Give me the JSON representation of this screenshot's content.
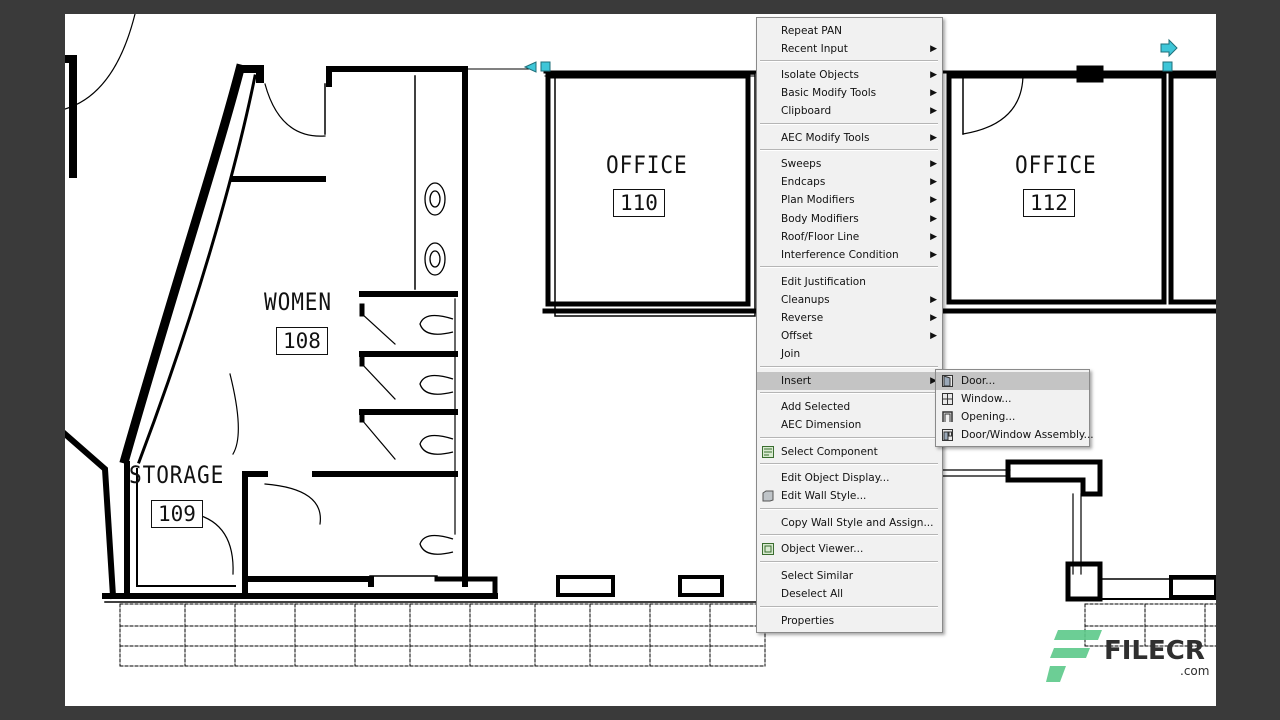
{
  "rooms": [
    {
      "name": "WOMEN",
      "number": "108"
    },
    {
      "name": "STORAGE",
      "number": "109"
    },
    {
      "name": "OFFICE",
      "number": "110"
    },
    {
      "name": "OFFICE",
      "number": "112"
    }
  ],
  "context_menu": {
    "groups": [
      [
        {
          "label": "Repeat PAN",
          "submenu": false
        },
        {
          "label": "Recent Input",
          "submenu": true
        }
      ],
      [
        {
          "label": "Isolate Objects",
          "submenu": true
        },
        {
          "label": "Basic Modify Tools",
          "submenu": true
        },
        {
          "label": "Clipboard",
          "submenu": true
        }
      ],
      [
        {
          "label": "AEC Modify Tools",
          "submenu": true
        }
      ],
      [
        {
          "label": "Sweeps",
          "submenu": true
        },
        {
          "label": "Endcaps",
          "submenu": true
        },
        {
          "label": "Plan Modifiers",
          "submenu": true
        },
        {
          "label": "Body Modifiers",
          "submenu": true
        },
        {
          "label": "Roof/Floor Line",
          "submenu": true
        },
        {
          "label": "Interference Condition",
          "submenu": true
        }
      ],
      [
        {
          "label": "Edit Justification",
          "submenu": false
        },
        {
          "label": "Cleanups",
          "submenu": true
        },
        {
          "label": "Reverse",
          "submenu": true
        },
        {
          "label": "Offset",
          "submenu": true
        },
        {
          "label": "Join",
          "submenu": false
        }
      ],
      [
        {
          "label": "Insert",
          "submenu": true,
          "highlighted": true
        }
      ],
      [
        {
          "label": "Add Selected",
          "submenu": false
        },
        {
          "label": "AEC Dimension",
          "submenu": false
        }
      ],
      [
        {
          "label": "Select Component",
          "submenu": false,
          "icon": "select-component-icon"
        }
      ],
      [
        {
          "label": "Edit Object Display...",
          "submenu": false
        },
        {
          "label": "Edit Wall Style...",
          "submenu": false,
          "icon": "wall-style-icon"
        }
      ],
      [
        {
          "label": "Copy Wall Style and Assign...",
          "submenu": false
        }
      ],
      [
        {
          "label": "Object Viewer...",
          "submenu": false,
          "icon": "object-viewer-icon"
        }
      ],
      [
        {
          "label": "Select Similar",
          "submenu": false
        },
        {
          "label": "Deselect All",
          "submenu": false
        }
      ],
      [
        {
          "label": "Properties",
          "submenu": false
        }
      ]
    ]
  },
  "insert_submenu": [
    {
      "label": "Door...",
      "icon": "door-icon",
      "highlighted": true
    },
    {
      "label": "Window...",
      "icon": "window-icon"
    },
    {
      "label": "Opening...",
      "icon": "opening-icon"
    },
    {
      "label": "Door/Window Assembly...",
      "icon": "door-window-assembly-icon"
    }
  ],
  "watermark": {
    "brand": "FILECR",
    "tld": ".com"
  },
  "colors": {
    "grip": "#3ec6d8",
    "highlight": "#c4c4c4",
    "menu_bg": "#f1f1f1",
    "frame": "#3a3a3a",
    "watermark_green": "#5cc98a"
  }
}
